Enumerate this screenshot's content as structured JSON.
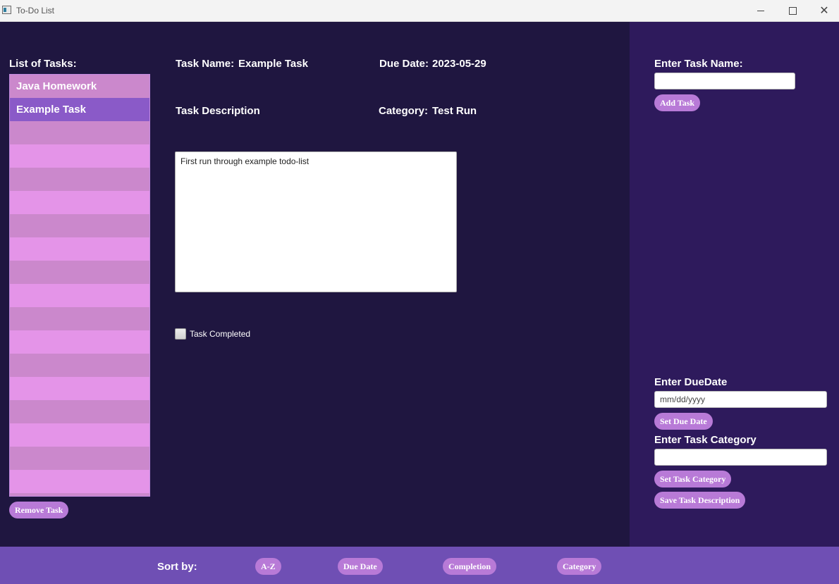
{
  "window": {
    "title": "To-Do List"
  },
  "left": {
    "heading": "List of Tasks:",
    "tasks": [
      "Java Homework",
      "Example Task"
    ],
    "selected_index": 1,
    "remove_button": "Remove Task"
  },
  "details": {
    "task_name_label": "Task Name:",
    "task_name_value": "Example Task",
    "due_date_label": "Due Date:",
    "due_date_value": "2023-05-29",
    "description_label": "Task Description",
    "category_label": "Category:",
    "category_value": "Test Run",
    "description_text": "First run through example todo-list",
    "completed_label": "Task Completed",
    "completed": false
  },
  "right": {
    "task_name_label": "Enter Task Name:",
    "task_name_input_value": "",
    "add_button": "Add Task",
    "due_date_label": "Enter DueDate",
    "due_date_placeholder": "mm/dd/yyyy",
    "set_due_button": "Set Due Date",
    "category_label": "Enter Task Category",
    "category_input_value": "",
    "set_category_button": "Set Task Category",
    "save_description_button": "Save Task Description"
  },
  "sort": {
    "label": "Sort by:",
    "options": [
      "A-Z",
      "Due Date",
      "Completion",
      "Category"
    ]
  },
  "colors": {
    "main_bg": "#1f1640",
    "panel_bg": "#2e1a5c",
    "bottom_bar": "#6f4fb4",
    "accent_button": "#b87ad7",
    "list_selected": "#8a5ac8"
  }
}
